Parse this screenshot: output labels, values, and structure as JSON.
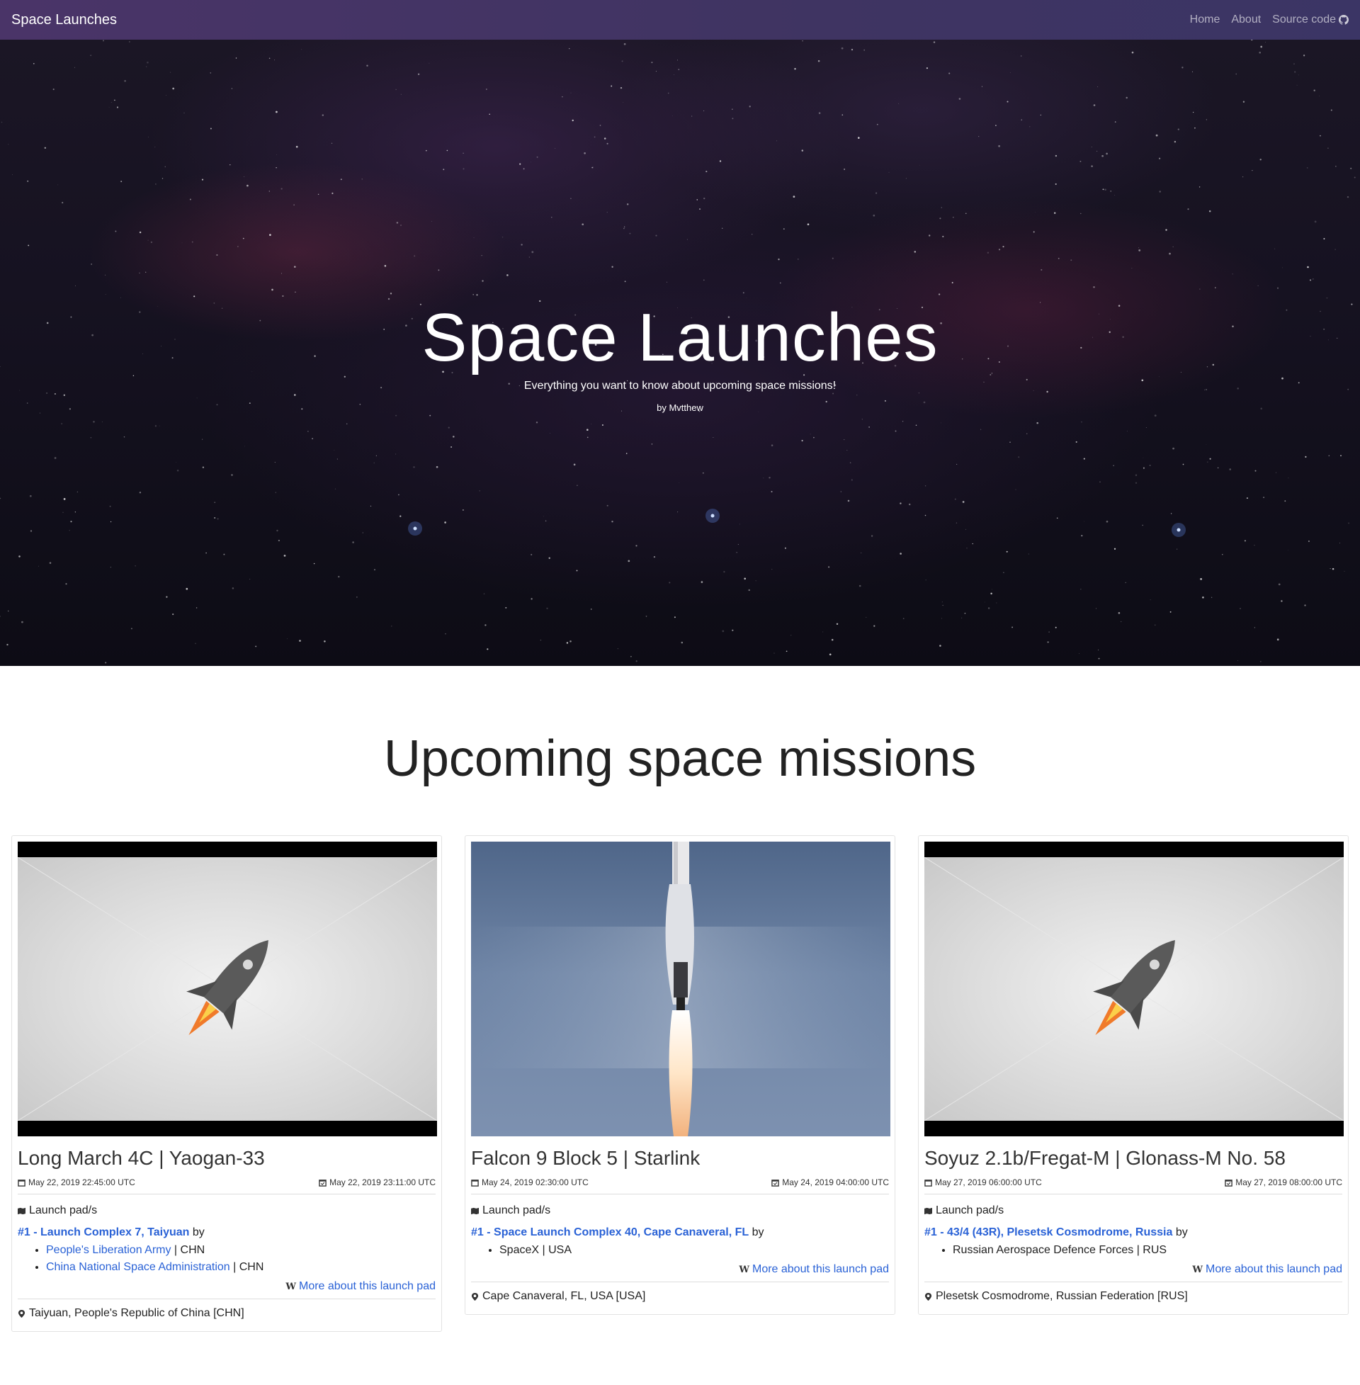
{
  "navbar": {
    "brand": "Space Launches",
    "links": [
      {
        "label": "Home"
      },
      {
        "label": "About"
      },
      {
        "label": "Source code"
      }
    ]
  },
  "hero": {
    "title": "Space Launches",
    "subtitle": "Everything you want to know about upcoming space missions!",
    "byline": "by Mvtthew"
  },
  "section": {
    "title": "Upcoming space missions"
  },
  "cards": [
    {
      "title": "Long March 4C | Yaogan-33",
      "window_start": "May 22, 2019 22:45:00 UTC",
      "window_end": "May 22, 2019 23:11:00 UTC",
      "pads_label": "Launch pad/s",
      "pad_link": "#1 - Launch Complex 7, Taiyuan",
      "by": "by",
      "agencies": [
        {
          "name": "People's Liberation Army",
          "country": " | CHN"
        },
        {
          "name": "China National Space Administration",
          "country": " | CHN"
        }
      ],
      "more_label": "More about this launch pad",
      "location": "Taiyuan, People's Republic of China [CHN]"
    },
    {
      "title": "Falcon 9 Block 5 | Starlink",
      "window_start": "May 24, 2019 02:30:00 UTC",
      "window_end": "May 24, 2019 04:00:00 UTC",
      "pads_label": "Launch pad/s",
      "pad_link": "#1 - Space Launch Complex 40, Cape Canaveral, FL",
      "by": "by",
      "agencies": [
        {
          "name": "SpaceX | USA"
        }
      ],
      "more_label": "More about this launch pad",
      "location": "Cape Canaveral, FL, USA [USA]"
    },
    {
      "title": "Soyuz 2.1b/Fregat-M | Glonass-M No. 58",
      "window_start": "May 27, 2019 06:00:00 UTC",
      "window_end": "May 27, 2019 08:00:00 UTC",
      "pads_label": "Launch pad/s",
      "pad_link": "#1 - 43/4 (43R), Plesetsk Cosmodrome, Russia",
      "by": "by",
      "agencies": [
        {
          "name": "Russian Aerospace Defence Forces | RUS"
        }
      ],
      "more_label": "More about this launch pad",
      "location": "Plesetsk Cosmodrome, Russian Federation [RUS]"
    }
  ],
  "colors": {
    "navbar": "#43346a",
    "link": "#2a62d6",
    "hero_text": "#ffffff"
  }
}
